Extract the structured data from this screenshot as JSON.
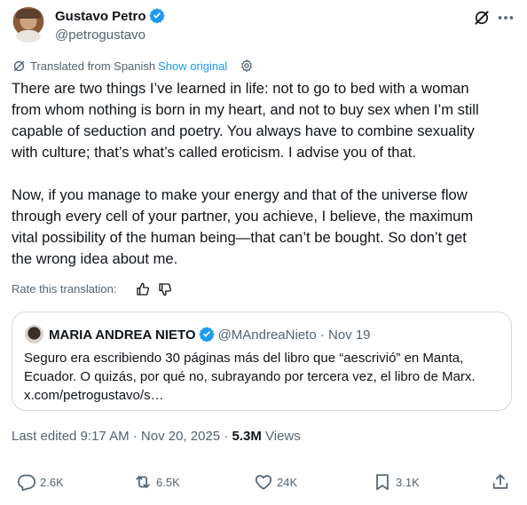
{
  "author": {
    "name": "Gustavo Petro",
    "handle": "@petrogustavo"
  },
  "translation": {
    "note": "Translated from Spanish",
    "show_original": "Show original",
    "rate_label": "Rate this translation:"
  },
  "tweet": {
    "lines": [
      "There are two things I’ve learned in life: not to go to bed with a woman",
      "from whom nothing is born in my heart, and not to buy sex when I’m still",
      "capable of seduction and poetry. You always have to combine sexuality",
      "with culture; that’s what’s called eroticism. I advise you of that.",
      "Now, if you manage to make your energy and that of the universe flow",
      "through every cell of your partner, you achieve, I believe, the maximum",
      "vital possibility of the human being—that can’t be bought. So don’t get",
      "the wrong idea about me."
    ]
  },
  "quote": {
    "name": "MARIA ANDREA NIETO",
    "handle_date": "@MAndreaNieto · Nov 19",
    "lines": [
      "Seguro era escribiendo 30 páginas más del libro que “aescrivió” en Manta,",
      "Ecuador. O quizás, por qué no, subrayando por tercera vez, el libro de Marx.",
      "x.com/petrogustavo/s…"
    ]
  },
  "meta": {
    "edited": "Last edited 9:17 AM · Nov 20, 2025 · ",
    "views_count": "5.3M",
    "views_label": " Views"
  },
  "actions": {
    "replies": "2.6K",
    "reposts": "6.5K",
    "likes": "24K",
    "bookmarks": "3.1K"
  },
  "colors": {
    "accent": "#1d9bf0",
    "muted": "#536471",
    "border": "#cfd9de"
  }
}
